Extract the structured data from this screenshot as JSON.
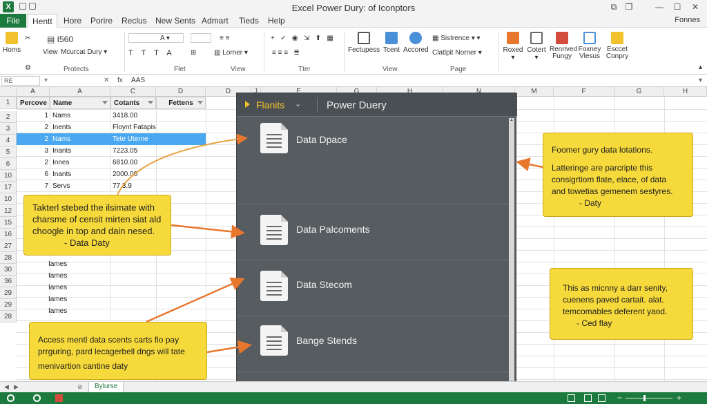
{
  "window": {
    "title": "Excel Power Dury: of Iconptors",
    "app_icon_label": "X"
  },
  "tabs": {
    "file": "File",
    "items": [
      "Hentt",
      "Hore",
      "Porire",
      "Reclus",
      "New Sents",
      "Admart",
      "Tieds",
      "Help"
    ],
    "right": "Fonnes"
  },
  "ribbon": {
    "homs": "Homs",
    "box1560": "I560",
    "view": "View",
    "mcurcat": "Mcurcat Dury",
    "protects": "Protects",
    "font_size": "A",
    "flet": "Flet",
    "lorner": "Lorner",
    "view_group": "View",
    "tter": "Tter",
    "fectupess": "Fectupess",
    "tcent": "Tcent",
    "accored": "Accored",
    "sistrence": "Sistrence",
    "clatlpit": "Clatlpit Norner",
    "view_group2": "View",
    "page_group": "Page",
    "roxed": "Roxed",
    "cotert": "Cotert",
    "renrived": "Renrived Fungy",
    "foxney": "Foxney Vlesus",
    "esccet": "Esccet Conpry"
  },
  "formula_bar": {
    "name_box": "RE",
    "fx": "fx",
    "value": "AAS"
  },
  "grid": {
    "col_headers": [
      "A",
      "A",
      "C",
      "D",
      "D",
      "J",
      "E",
      "G",
      "H",
      "N",
      "M",
      "F",
      "G",
      "H"
    ],
    "row_headers": [
      "1",
      "2",
      "3",
      "4",
      "5",
      "6",
      "10",
      "17",
      "10",
      "12",
      "15",
      "16",
      "27",
      "28",
      "30",
      "36",
      "29",
      "29",
      "28"
    ],
    "header_cells": [
      "Percove",
      "Name",
      "Cotants",
      "Fettens"
    ],
    "rows": [
      {
        "num": "1",
        "name": "Nams",
        "val": "3418.00"
      },
      {
        "num": "2",
        "name": "Inents",
        "val": "Floynt Fatapis"
      },
      {
        "num": "2",
        "name": "Nams",
        "val": "Tete Uterne"
      },
      {
        "num": "3",
        "name": "Inants",
        "val": "7223.05"
      },
      {
        "num": "2",
        "name": "Innes",
        "val": "6810.00"
      },
      {
        "num": "6",
        "name": "Inants",
        "val": "2000.00"
      },
      {
        "num": "7",
        "name": "Servs",
        "val": "77.3.9"
      }
    ],
    "lower_names": [
      "Iames",
      "Iames",
      "Iames",
      "Iames",
      "Iames"
    ]
  },
  "pane": {
    "menu": "Flanits",
    "title": "Power Duery",
    "items": [
      "Data Dpace",
      "Data Palcoments",
      "Data Stecom",
      "Bange Stends"
    ]
  },
  "callouts": {
    "left_top": {
      "lines": [
        "Takterl stebed the ilsimate with",
        "charsme of censit mirten siat ald",
        "choogle in top and dain nesed."
      ],
      "sig": "- Data Daty"
    },
    "left_bottom": {
      "lines": [
        "Access mentl data scents carts fio pay",
        "prrguring, pard lecagerbell dngs will tate",
        "menivartion cantine daty"
      ]
    },
    "right_top": {
      "lines": [
        "Foomer gury data lotations.",
        "Latteringe are parcripte this",
        "consigrtiom flate, elace, of data",
        "and towetias gemenem sestyres."
      ],
      "sig": "- Daty"
    },
    "right_bottom": {
      "lines": [
        "This as micnny a darr senity,",
        "cuenens paved cartait. alat.",
        "temcomables deferent yaod."
      ],
      "sig": "- Ced flay"
    }
  },
  "sheet": {
    "tab": "Bylurse"
  },
  "colors": {
    "excel_green": "#1d7a3e",
    "callout_yellow": "#f6d93b",
    "arrow_orange": "#e8772e",
    "pane_gray": "#575c60",
    "selection_blue": "#49a8f0"
  }
}
